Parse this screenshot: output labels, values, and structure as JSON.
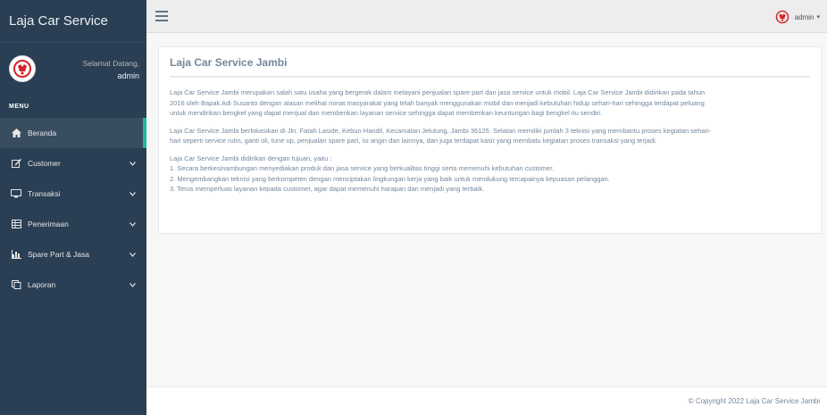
{
  "sidebar": {
    "brand": "Laja Car Service",
    "profile": {
      "greeting": "Selamat Datang,",
      "username": "admin"
    },
    "menu_heading": "MENU",
    "items": [
      {
        "label": "Beranda",
        "icon": "home-icon",
        "expandable": false,
        "active": true
      },
      {
        "label": "Customer",
        "icon": "edit-icon",
        "expandable": true,
        "active": false
      },
      {
        "label": "Transaksi",
        "icon": "desktop-icon",
        "expandable": true,
        "active": false
      },
      {
        "label": "Penerimaan",
        "icon": "table-icon",
        "expandable": true,
        "active": false
      },
      {
        "label": "Spare Part & Jasa",
        "icon": "bar-chart-icon",
        "expandable": true,
        "active": false
      },
      {
        "label": "Laporan",
        "icon": "clone-icon",
        "expandable": true,
        "active": false
      }
    ]
  },
  "topbar": {
    "user": "admin"
  },
  "content": {
    "title": "Laja Car Service Jambi",
    "paragraphs": [
      [
        "Laja Car Service Jambi merupakan salah satu usaha yang bergerak dalam melayani penjualan spare part dan jasa service untuk mobil. Laja Car Service Jambi didirikan pada tahun",
        "2016 oleh Bapak Adi Susanto dengan alasan melihat minat masyarakat yang telah banyak menggunakan mobil dan menjadi kebutuhan hidup sehari-hari sehingga terdapat peluang",
        "untuk mendirikan bengkel yang dapat menjual dan memberikan layanan service sehingga dapat memberikan keuntungan bagi bengkel itu sendiri."
      ],
      [
        "Laja Car Service Jambi berlokasikan di Jln. Fatah Laside, Kebun Handil, Kecamatan Jelutung, Jambi 36125. Selatan memiliki jumlah 3 teknisi yang membantu proses kegiatan sehari-",
        "hari seperti service rutin, ganti oli, tune up, penjualan spare part, isi angin dan lainnya, dan juga terdapat kasir yang membatu kegiatan proses transaksi yang terjadi."
      ],
      [
        "Laja Car Service Jambi didirikan dengan tujuan, yaitu :",
        "1. Secara berkesinambungan menyediakan produk dan jasa service yang berkualitas tinggi serta memenuhi kebutuhan customer.",
        "2. Mengembangkan teknisi yang berkompeten dengan menciptakan lingkungan kerja yang baik untuk mendukung tercapainya kepuasan pelanggan.",
        "3. Terus memperluas layanan kepada customer, agar dapat memenuhi harapan dan menjadi yang terbaik."
      ]
    ]
  },
  "footer": {
    "copyright": "© Copyright 2022 Laja Car Service Jambi"
  },
  "colors": {
    "sidebar": "#2a3f54",
    "accent": "#1abb9c",
    "logo": "#d2232a"
  }
}
